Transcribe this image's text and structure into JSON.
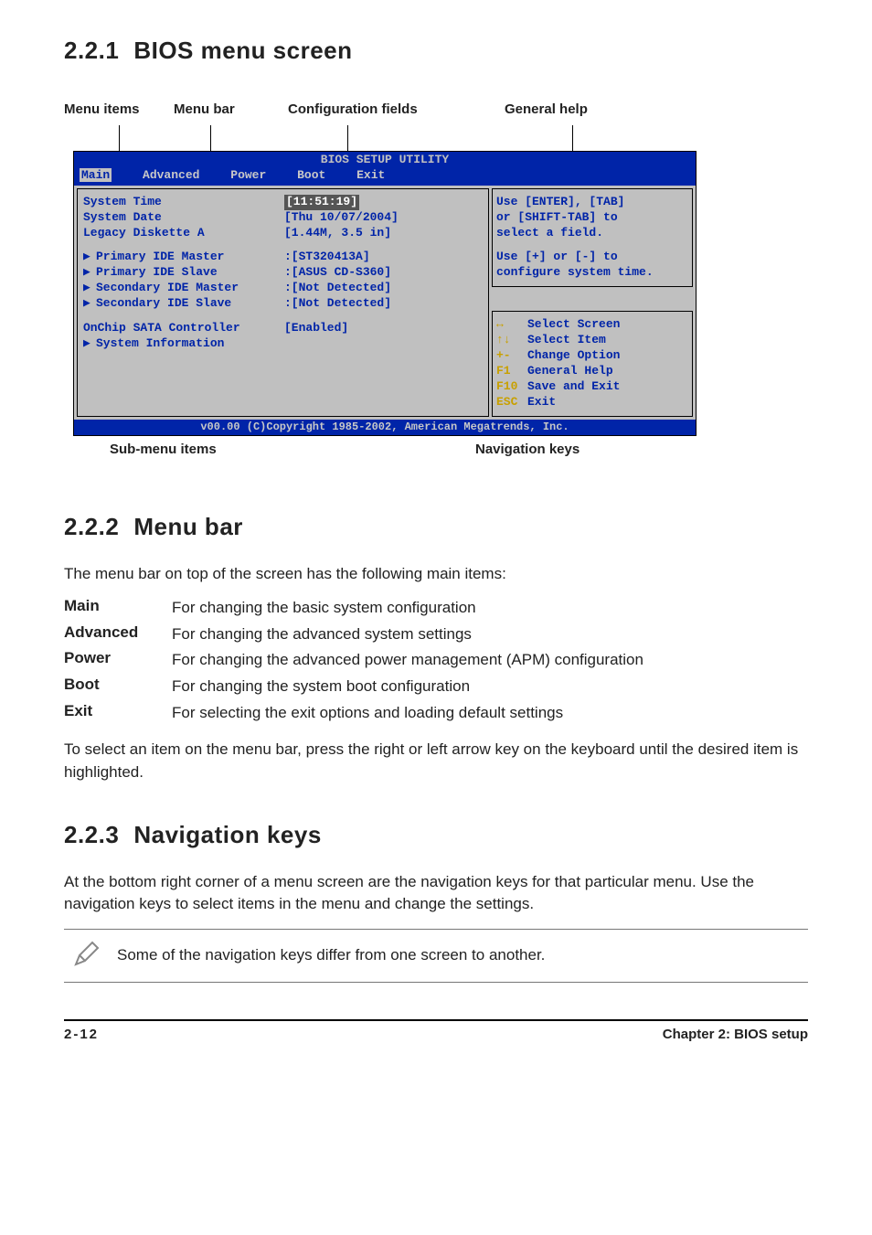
{
  "sections": {
    "s221_num": "2.2.1",
    "s221_title": "BIOS menu screen",
    "s222_num": "2.2.2",
    "s222_title": "Menu bar",
    "s223_num": "2.2.3",
    "s223_title": "Navigation keys"
  },
  "annotations": {
    "menu_items": "Menu items",
    "menu_bar": "Menu bar",
    "config_fields": "Configuration fields",
    "general_help": "General help",
    "sub_menu_items": "Sub-menu items",
    "navigation_keys": "Navigation keys"
  },
  "bios": {
    "title": "BIOS SETUP UTILITY",
    "menus": {
      "main": "Main",
      "advanced": "Advanced",
      "power": "Power",
      "boot": "Boot",
      "exit": "Exit"
    },
    "items": {
      "system_time": {
        "label": "System Time",
        "value": "[11:51:19]"
      },
      "system_date": {
        "label": "System Date",
        "value": "[Thu 10/07/2004]"
      },
      "legacy_diskette": {
        "label": "Legacy Diskette A",
        "value": "[1.44M, 3.5 in]"
      },
      "pri_master": {
        "label": "Primary IDE Master",
        "value": ":[ST320413A]"
      },
      "pri_slave": {
        "label": "Primary IDE Slave",
        "value": ":[ASUS CD-S360]"
      },
      "sec_master": {
        "label": "Secondary IDE Master",
        "value": ":[Not Detected]"
      },
      "sec_slave": {
        "label": "Secondary IDE Slave",
        "value": ":[Not Detected]"
      },
      "onchip_sata": {
        "label": "OnChip SATA Controller",
        "value": "[Enabled]"
      },
      "sysinfo": {
        "label": "System Information"
      }
    },
    "help": {
      "l1": "Use [ENTER], [TAB]",
      "l2": "or [SHIFT-TAB] to",
      "l3": "select a field.",
      "l4": "Use [+]  or [-] to",
      "l5": "configure system time."
    },
    "navkeys": [
      {
        "key": "↔",
        "desc": "Select Screen"
      },
      {
        "key": "↑↓",
        "desc": "Select Item"
      },
      {
        "key": "+-",
        "desc": "Change Option"
      },
      {
        "key": "F1",
        "desc": "General Help"
      },
      {
        "key": "F10",
        "desc": "Save and Exit"
      },
      {
        "key": "ESC",
        "desc": "Exit"
      }
    ],
    "copyright": "v00.00 (C)Copyright 1985-2002, American Megatrends, Inc."
  },
  "menubar_intro": "The menu bar on top of the screen has the following main items:",
  "menubar_items": [
    {
      "term": "Main",
      "desc": "For changing the basic system configuration"
    },
    {
      "term": "Advanced",
      "desc": "For changing the advanced system settings"
    },
    {
      "term": "Power",
      "desc": "For changing the advanced power management (APM) configuration"
    },
    {
      "term": "Boot",
      "desc": "For changing the system boot configuration"
    },
    {
      "term": "Exit",
      "desc": "For selecting the exit options and loading default settings"
    }
  ],
  "menubar_note": "To select an item on the menu bar, press the right or left arrow key on the keyboard until the desired item is highlighted.",
  "navkeys_para": "At the bottom right corner of a menu screen are the navigation keys for that particular menu. Use the navigation keys to select items in the menu and change the settings.",
  "note_text": "Some of the navigation keys differ from one screen to another.",
  "footer": {
    "left": "2-12",
    "right": "Chapter 2: BIOS setup"
  }
}
